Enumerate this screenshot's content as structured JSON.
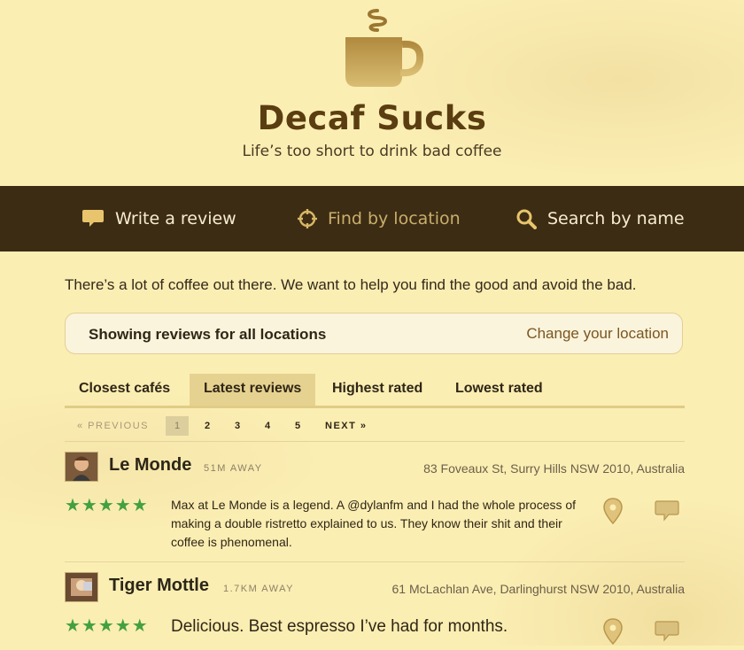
{
  "header": {
    "title": "Decaf Sucks",
    "tagline": "Life’s too short to drink bad coffee"
  },
  "nav": {
    "write_review": "Write a review",
    "find_location": "Find by location",
    "search_name": "Search by name"
  },
  "intro": "There’s a lot of coffee out there. We want to help you find the good and avoid the bad.",
  "location": {
    "showing": "Showing reviews for all locations",
    "change": "Change your location"
  },
  "tabs": [
    {
      "label": "Closest cafés",
      "active": false
    },
    {
      "label": "Latest reviews",
      "active": true
    },
    {
      "label": "Highest rated",
      "active": false
    },
    {
      "label": "Lowest rated",
      "active": false
    }
  ],
  "pagination": {
    "previous": "« PREVIOUS",
    "pages": [
      "1",
      "2",
      "3",
      "4",
      "5"
    ],
    "current": "1",
    "next": "NEXT »"
  },
  "reviews": [
    {
      "cafe": "Le Monde",
      "distance": "51M AWAY",
      "address": "83 Foveaux St, Surry Hills NSW 2010, Australia",
      "stars": "★★★★★",
      "rating": 5,
      "text": "Max at Le Monde is a legend. A @dylanfm and I had the whole process of making a double ristretto explained to us. They know their shit and their coffee is phenomenal."
    },
    {
      "cafe": "Tiger Mottle",
      "distance": "1.7KM AWAY",
      "address": "61 McLachlan Ave, Darlinghurst NSW 2010, Australia",
      "stars": "★★★★★",
      "rating": 5,
      "text": "Delicious. Best espresso I’ve had for months."
    }
  ],
  "colors": {
    "background": "#fbeeb3",
    "nav_bar": "#3c2c14",
    "title": "#5a3d10",
    "stars": "#43a040",
    "active_tab": "#e6d290"
  },
  "icons": {
    "logo": "coffee-cup-icon",
    "write": "speech-bubble-icon",
    "find": "crosshair-icon",
    "search": "magnifier-icon",
    "pin": "map-pin-icon",
    "comment": "comment-bubble-icon"
  }
}
